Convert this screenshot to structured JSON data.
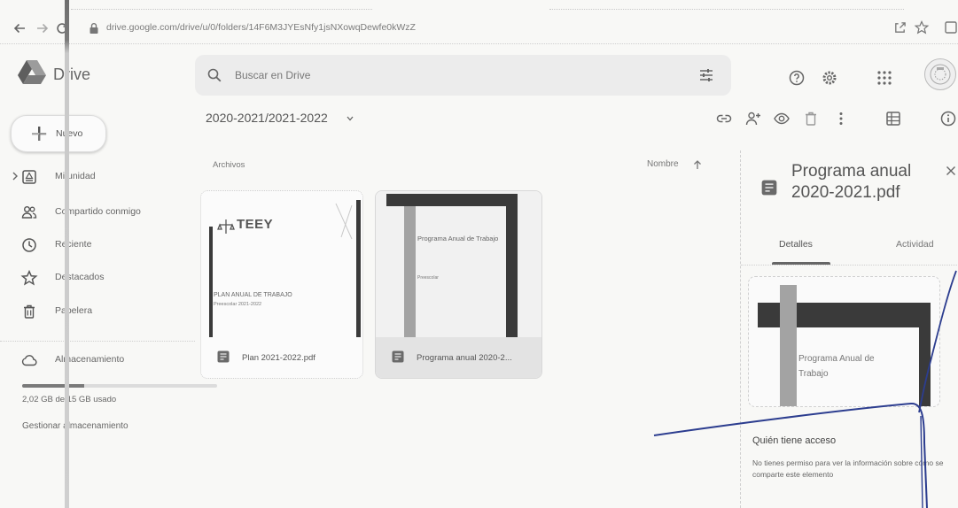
{
  "browser": {
    "url": "drive.google.com/drive/u/0/folders/14F6M3JYEsNfy1jsNXowqDewfe0kWzZ",
    "icons": {
      "back": "back-arrow-icon",
      "forward": "forward-arrow-icon",
      "reload": "reload-icon",
      "lock": "lock-icon",
      "share": "share-icon",
      "bookmark": "star-icon",
      "window": "window-icon"
    }
  },
  "header": {
    "app_name": "Drive",
    "logo_icon": "drive-logo-icon",
    "search": {
      "placeholder": "Buscar en Drive",
      "icon": "search-icon",
      "options_icon": "tune-icon"
    },
    "actions": [
      "help-icon",
      "settings-gear-icon",
      "apps-grid-icon",
      "account-avatar"
    ]
  },
  "sidebar": {
    "new_button": {
      "label": "Nuevo",
      "icon": "plus-icon"
    },
    "items": [
      {
        "label": "Mi unidad",
        "icon": "my-drive-icon"
      },
      {
        "label": "Compartido conmigo",
        "icon": "shared-with-me-icon"
      },
      {
        "label": "Reciente",
        "icon": "clock-icon"
      },
      {
        "label": "Destacados",
        "icon": "star-icon"
      },
      {
        "label": "Papelera",
        "icon": "trash-icon"
      }
    ],
    "storage": {
      "label": "Almacenamiento",
      "icon": "cloud-icon",
      "usage_text": "2,02 GB de 15 GB usado",
      "used_fraction": 0.32,
      "manage_label": "Gestionar almacenamiento"
    }
  },
  "main": {
    "breadcrumb": "2020-2021/2021-2022",
    "toolbar_icons": [
      "link-icon",
      "add-person-icon",
      "preview-eye-icon",
      "trash-icon",
      "more-vertical-icon",
      "grid-view-icon",
      "info-icon"
    ],
    "section_label": "Archivos",
    "sort": {
      "label": "Nombre",
      "icon": "arrow-up-icon"
    },
    "files": [
      {
        "name": "Plan 2021-2022.pdf",
        "type_icon": "pdf-icon",
        "selected": false,
        "thumbnail": {
          "logo_text": "TEEY",
          "title": "PLAN ANUAL DE TRABAJO",
          "subtitle": "Preescolar 2021-2022"
        }
      },
      {
        "name": "Programa anual 2020-2...",
        "type_icon": "pdf-icon",
        "selected": true,
        "thumbnail": {
          "title": "Programa Anual de Trabajo",
          "subtitle": "Preescolar"
        }
      }
    ]
  },
  "details": {
    "title": "Programa anual 2020-2021.pdf",
    "type_icon": "pdf-icon",
    "close_icon": "close-icon",
    "tabs": [
      {
        "label": "Detalles",
        "active": true
      },
      {
        "label": "Actividad",
        "active": false
      }
    ],
    "preview_text": "Programa Anual de Trabajo",
    "access_heading": "Quién tiene acceso",
    "access_text": "No tienes permiso para ver la información sobre cómo se comparte este elemento"
  },
  "colors": {
    "text": "#5a5a5a",
    "selected_bg": "#e3e3e3",
    "pen_ink": "#2c3d8f"
  }
}
